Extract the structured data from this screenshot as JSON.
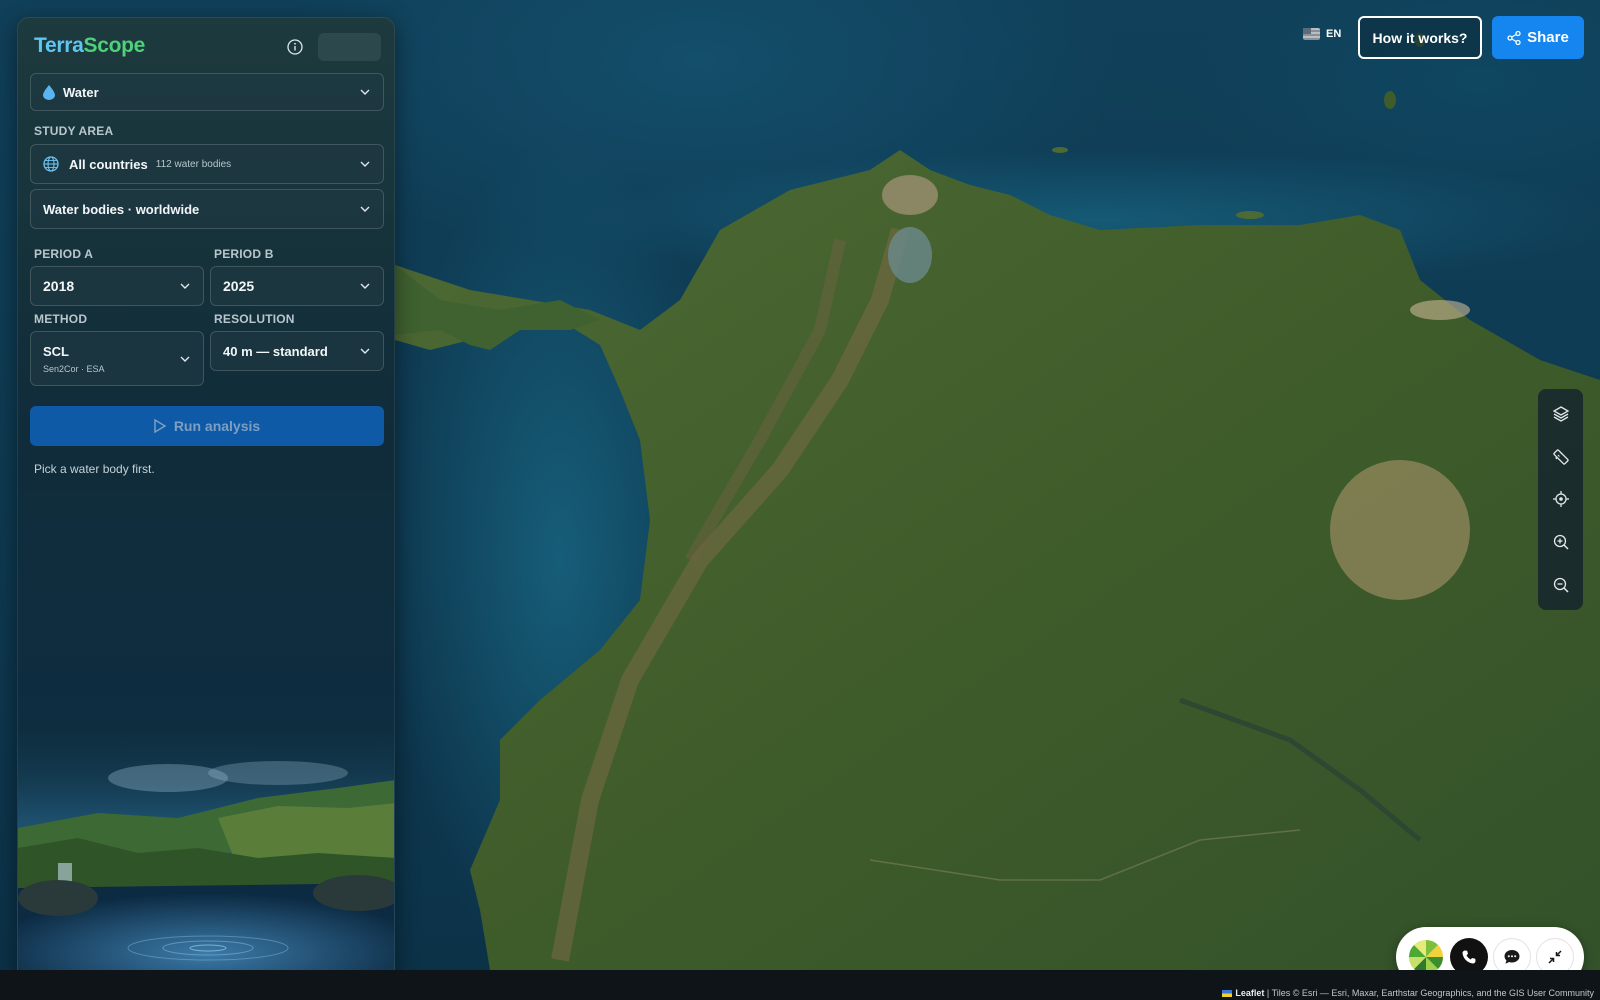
{
  "app": {
    "brand_part1": "Terra",
    "brand_part2": "Scope"
  },
  "sidebar": {
    "theme_select": {
      "label": "Water",
      "icon": "water-drop-icon"
    },
    "study_area_label": "STUDY AREA",
    "country_select": {
      "label": "All countries",
      "sub": "112 water bodies",
      "icon": "globe-icon"
    },
    "body_select": {
      "label": "Water bodies · worldwide"
    },
    "period_a_label": "PERIOD A",
    "period_a_value": "2018",
    "period_b_label": "PERIOD B",
    "period_b_value": "2025",
    "method_label": "METHOD",
    "method_value": "SCL",
    "method_sub": "Sen2Cor · ESA",
    "resolution_label": "RESOLUTION",
    "resolution_value": "40 m — standard",
    "run_label": "Run analysis",
    "hint": "Pick a water body first."
  },
  "topbar": {
    "lang": "EN",
    "how_label": "How it works?",
    "share_label": "Share"
  },
  "map_tools": [
    "layers-icon",
    "ruler-icon",
    "locate-icon",
    "zoom-in-icon",
    "zoom-out-icon"
  ],
  "widget": [
    "logo-icon",
    "phone-icon",
    "chat-icon",
    "collapse-icon"
  ],
  "attribution": {
    "leaflet": "Leaflet",
    "tiles": "| Tiles © Esri — Esri, Maxar, Earthstar Geographics, and the GIS User Community"
  },
  "colors": {
    "accent_blue": "#1585f0",
    "brand_terra": "#5ec6f0",
    "brand_scope": "#4fd17a",
    "run_button": "#0e5aa6"
  }
}
